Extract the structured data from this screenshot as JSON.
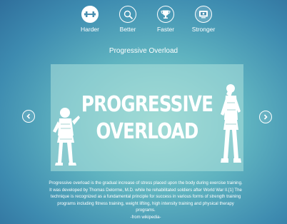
{
  "nav": {
    "items": [
      {
        "label": "Harder",
        "icon": "dumbbell-icon"
      },
      {
        "label": "Better",
        "icon": "magnifier-icon"
      },
      {
        "label": "Faster",
        "icon": "trophy-icon"
      },
      {
        "label": "Stronger",
        "icon": "monitor-icon"
      }
    ]
  },
  "page": {
    "title": "Progressive Overload"
  },
  "banner": {
    "line1": "PROGRESSIVE",
    "line2": "OVERLOAD"
  },
  "description": {
    "lines": [
      "Progressive overload is the gradual increase of stress placed upon the body during exercise training.",
      "It was developed by Thomas Delorme, M.D. while he rehabilitated soldiers after World War II.[1] The",
      "technique is recognized as a fundamental principle for success in various forms of strength training",
      "programs including fitness training, weight lifting, high intensity training and physical therapy",
      "programs.",
      "-from wikipedia-"
    ]
  },
  "colors": {
    "background_center": "#8fd3cd",
    "background_edge": "#2f6f9c",
    "banner_overlay": "#afe1dc"
  }
}
